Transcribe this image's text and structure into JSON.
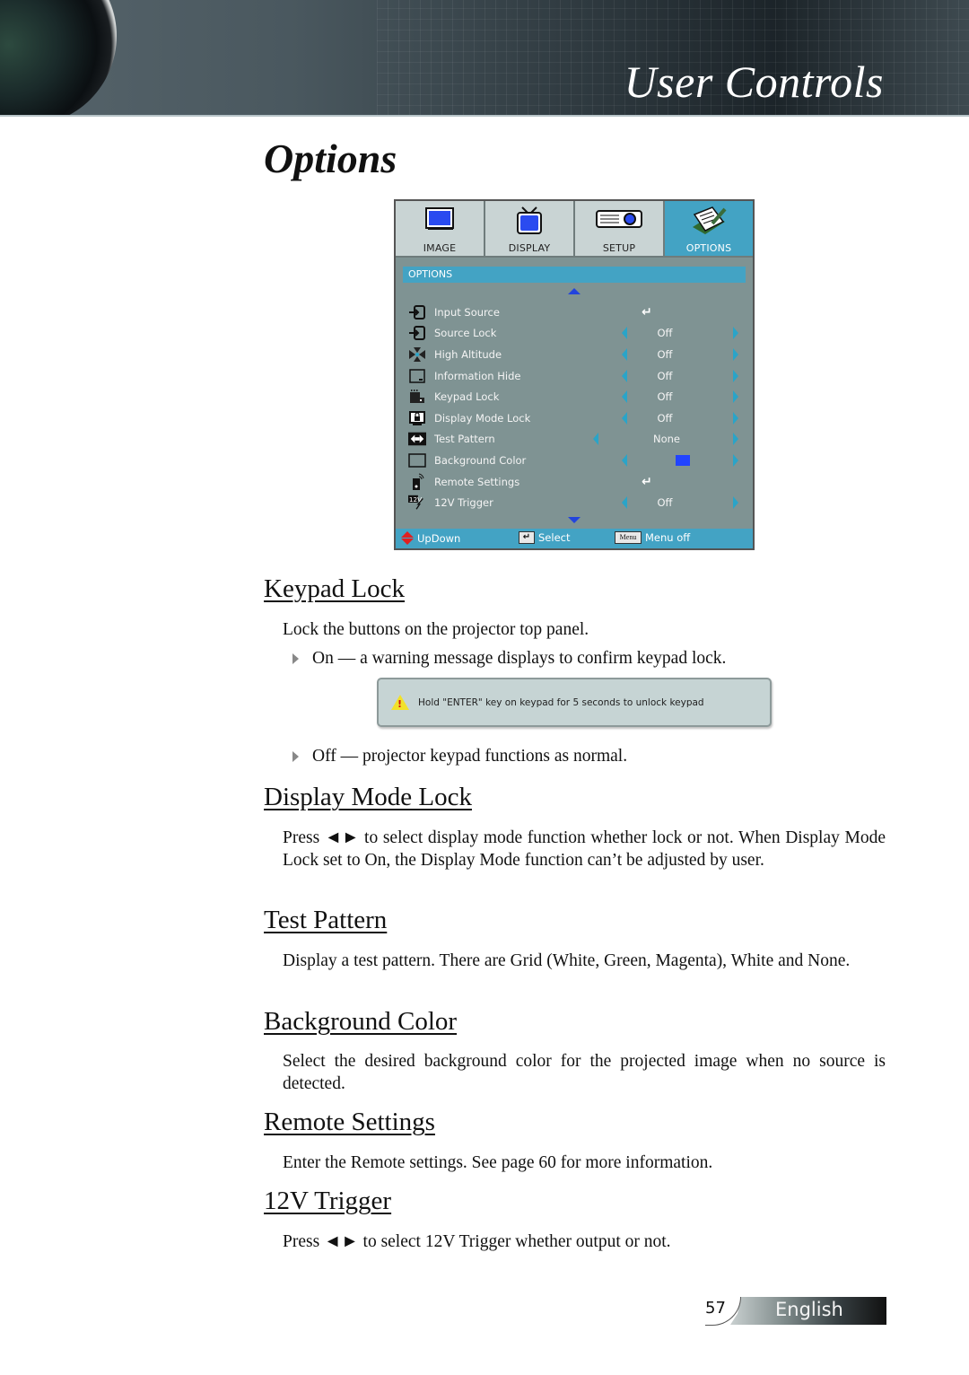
{
  "header": {
    "section_title": "User Controls"
  },
  "page_title": "Options",
  "osd_menu": {
    "tabs": [
      {
        "label": "IMAGE",
        "icon": "image-icon",
        "active": false
      },
      {
        "label": "DISPLAY",
        "icon": "display-tv-icon",
        "active": false
      },
      {
        "label": "SETUP",
        "icon": "projector-icon",
        "active": false
      },
      {
        "label": "OPTIONS",
        "icon": "notepad-pencil-icon",
        "active": true
      }
    ],
    "section_label": "OPTIONS",
    "items": [
      {
        "label": "Input Source",
        "icon": "input-source-icon",
        "value": "",
        "type": "enter"
      },
      {
        "label": "Source Lock",
        "icon": "source-lock-icon",
        "value": "Off",
        "type": "toggle"
      },
      {
        "label": "High Altitude",
        "icon": "fan-icon",
        "value": "Off",
        "type": "toggle"
      },
      {
        "label": "Information Hide",
        "icon": "information-hide-icon",
        "value": "Off",
        "type": "toggle"
      },
      {
        "label": "Keypad Lock",
        "icon": "keypad-icon",
        "value": "Off",
        "type": "toggle"
      },
      {
        "label": "Display Mode Lock",
        "icon": "display-mode-lock-icon",
        "value": "Off",
        "type": "toggle"
      },
      {
        "label": "Test Pattern",
        "icon": "test-pattern-icon",
        "value": "None",
        "type": "toggle-wide"
      },
      {
        "label": "Background Color",
        "icon": "background-color-icon",
        "value": "",
        "swatch_color": "#2244ff",
        "type": "color"
      },
      {
        "label": "Remote Settings",
        "icon": "remote-icon",
        "value": "",
        "type": "enter"
      },
      {
        "label": "12V Trigger",
        "icon": "12v-trigger-icon",
        "value": "Off",
        "type": "toggle"
      }
    ],
    "footer": {
      "updown_label": "UpDown",
      "select_label": "Select",
      "select_key": "↵",
      "menu_key": "Menu",
      "menu_label": "Menu off"
    },
    "colors": {
      "accent": "#43a3c4",
      "panel": "#7f9393",
      "tab": "#c9d4d4"
    }
  },
  "sections": {
    "keypad_lock": {
      "heading": "Keypad Lock",
      "intro": "Lock the buttons on the projector top panel.",
      "bullet_on": "On — a warning message displays to confirm keypad lock.",
      "warning_text": "Hold \"ENTER\" key on keypad for 5 seconds to unlock keypad",
      "bullet_off": "Off — projector keypad functions as normal."
    },
    "display_mode_lock": {
      "heading": "Display Mode Lock",
      "text": "Press ◄► to select display mode function whether lock or not. When Display Mode Lock set to On, the Display Mode function can’t be adjusted by user."
    },
    "test_pattern": {
      "heading": "Test Pattern",
      "text": "Display a test pattern. There are Grid (White, Green, Magenta), White and None."
    },
    "background_color": {
      "heading": "Background Color",
      "text": "Select the desired background color for the projected image when no source is detected."
    },
    "remote_settings": {
      "heading": "Remote Settings",
      "text": "Enter the Remote settings. See page 60 for more information."
    },
    "trigger_12v": {
      "heading": "12V Trigger",
      "text": "Press ◄► to select 12V Trigger whether output or not."
    }
  },
  "footer": {
    "page_number": "57",
    "language": "English"
  }
}
